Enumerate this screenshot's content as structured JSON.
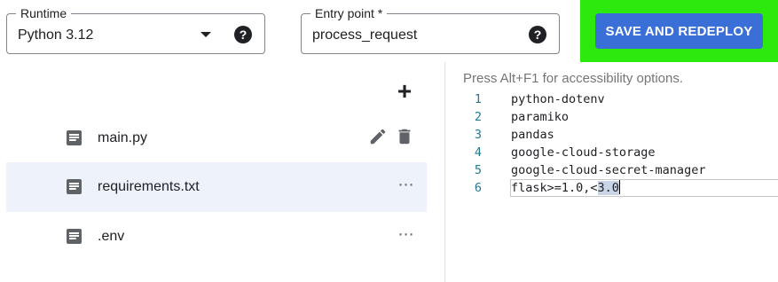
{
  "runtime": {
    "label": "Runtime",
    "value": "Python 3.12",
    "help_icon": "?"
  },
  "entry_point": {
    "label": "Entry point *",
    "value": "process_request",
    "help_icon": "?"
  },
  "deploy_button": {
    "label": "SAVE AND REDEPLOY",
    "color": "#3b6fd8",
    "highlight_color": "#2ee90d"
  },
  "files": {
    "add_icon": "+",
    "items": [
      {
        "name": "main.py",
        "icon": "file-icon",
        "selected": false,
        "actions": [
          "edit-icon",
          "delete-icon"
        ]
      },
      {
        "name": "requirements.txt",
        "icon": "file-icon",
        "selected": true,
        "actions": [
          "more-icon"
        ]
      },
      {
        "name": ".env",
        "icon": "file-icon",
        "selected": false,
        "actions": [
          "more-icon"
        ]
      }
    ],
    "more_glyph": "⋯"
  },
  "editor": {
    "hint": "Press Alt+F1 for accessibility options.",
    "lines": [
      {
        "num": "1",
        "text": "python-dotenv"
      },
      {
        "num": "2",
        "text": "paramiko"
      },
      {
        "num": "3",
        "text": "pandas"
      },
      {
        "num": "4",
        "text": "google-cloud-storage"
      },
      {
        "num": "5",
        "text": "google-cloud-secret-manager"
      },
      {
        "num": "6",
        "text_before": "flask>=1.0,<",
        "text_selected": "3.0"
      }
    ]
  }
}
